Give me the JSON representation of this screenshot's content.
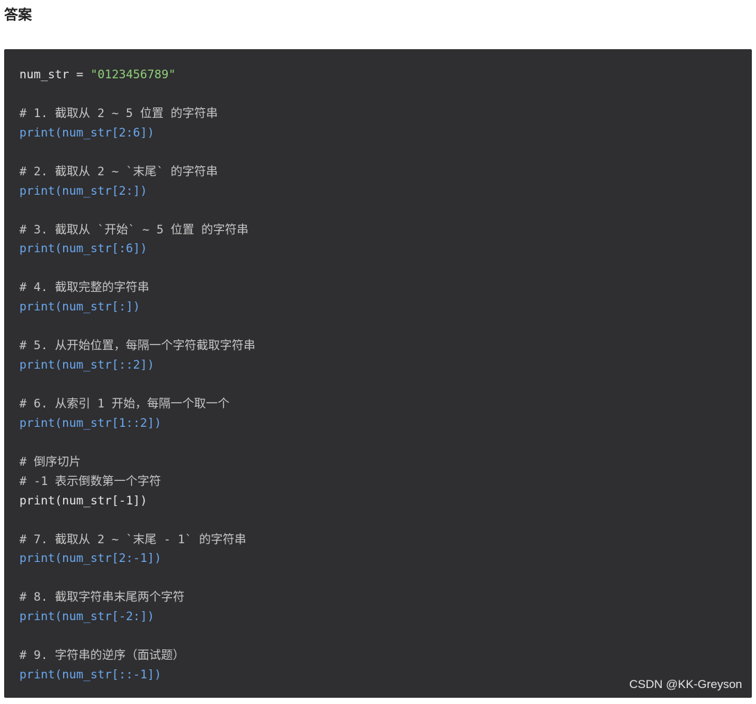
{
  "heading": "答案",
  "code": {
    "lines": [
      {
        "parts": [
          {
            "t": "num_str = ",
            "c": "plain"
          },
          {
            "t": "\"0123456789\"",
            "c": "str"
          }
        ]
      },
      {
        "parts": [
          {
            "t": "",
            "c": "plain"
          }
        ]
      },
      {
        "parts": [
          {
            "t": "# 1. 截取从 2 ~ 5 位置 的字符串",
            "c": "comment"
          }
        ]
      },
      {
        "parts": [
          {
            "t": "print(num_str[2:6])",
            "c": "call"
          }
        ]
      },
      {
        "parts": [
          {
            "t": "",
            "c": "plain"
          }
        ]
      },
      {
        "parts": [
          {
            "t": "# 2. 截取从 2 ~ `末尾` 的字符串",
            "c": "comment"
          }
        ]
      },
      {
        "parts": [
          {
            "t": "print(num_str[2:])",
            "c": "call"
          }
        ]
      },
      {
        "parts": [
          {
            "t": "",
            "c": "plain"
          }
        ]
      },
      {
        "parts": [
          {
            "t": "# 3. 截取从 `开始` ~ 5 位置 的字符串",
            "c": "comment"
          }
        ]
      },
      {
        "parts": [
          {
            "t": "print(num_str[:6])",
            "c": "call"
          }
        ]
      },
      {
        "parts": [
          {
            "t": "",
            "c": "plain"
          }
        ]
      },
      {
        "parts": [
          {
            "t": "# 4. 截取完整的字符串",
            "c": "comment"
          }
        ]
      },
      {
        "parts": [
          {
            "t": "print(num_str[:])",
            "c": "call"
          }
        ]
      },
      {
        "parts": [
          {
            "t": "",
            "c": "plain"
          }
        ]
      },
      {
        "parts": [
          {
            "t": "# 5. 从开始位置，每隔一个字符截取字符串",
            "c": "comment"
          }
        ]
      },
      {
        "parts": [
          {
            "t": "print(num_str[::2])",
            "c": "call"
          }
        ]
      },
      {
        "parts": [
          {
            "t": "",
            "c": "plain"
          }
        ]
      },
      {
        "parts": [
          {
            "t": "# 6. 从索引 1 开始，每隔一个取一个",
            "c": "comment"
          }
        ]
      },
      {
        "parts": [
          {
            "t": "print(num_str[1::2])",
            "c": "call"
          }
        ]
      },
      {
        "parts": [
          {
            "t": "",
            "c": "plain"
          }
        ]
      },
      {
        "parts": [
          {
            "t": "# 倒序切片",
            "c": "comment"
          }
        ]
      },
      {
        "parts": [
          {
            "t": "# -1 表示倒数第一个字符",
            "c": "comment"
          }
        ]
      },
      {
        "parts": [
          {
            "t": "print(num_str[-1])",
            "c": "plaincall"
          }
        ]
      },
      {
        "parts": [
          {
            "t": "",
            "c": "plain"
          }
        ]
      },
      {
        "parts": [
          {
            "t": "# 7. 截取从 2 ~ `末尾 - 1` 的字符串",
            "c": "comment"
          }
        ]
      },
      {
        "parts": [
          {
            "t": "print(num_str[2:-1])",
            "c": "call"
          }
        ]
      },
      {
        "parts": [
          {
            "t": "",
            "c": "plain"
          }
        ]
      },
      {
        "parts": [
          {
            "t": "# 8. 截取字符串末尾两个字符",
            "c": "comment"
          }
        ]
      },
      {
        "parts": [
          {
            "t": "print(num_str[-2:])",
            "c": "call"
          }
        ]
      },
      {
        "parts": [
          {
            "t": "",
            "c": "plain"
          }
        ]
      },
      {
        "parts": [
          {
            "t": "# 9. 字符串的逆序（面试题）",
            "c": "comment"
          }
        ]
      },
      {
        "parts": [
          {
            "t": "print(num_str[::-1])",
            "c": "call"
          }
        ]
      }
    ]
  },
  "watermark": "CSDN @KK-Greyson"
}
